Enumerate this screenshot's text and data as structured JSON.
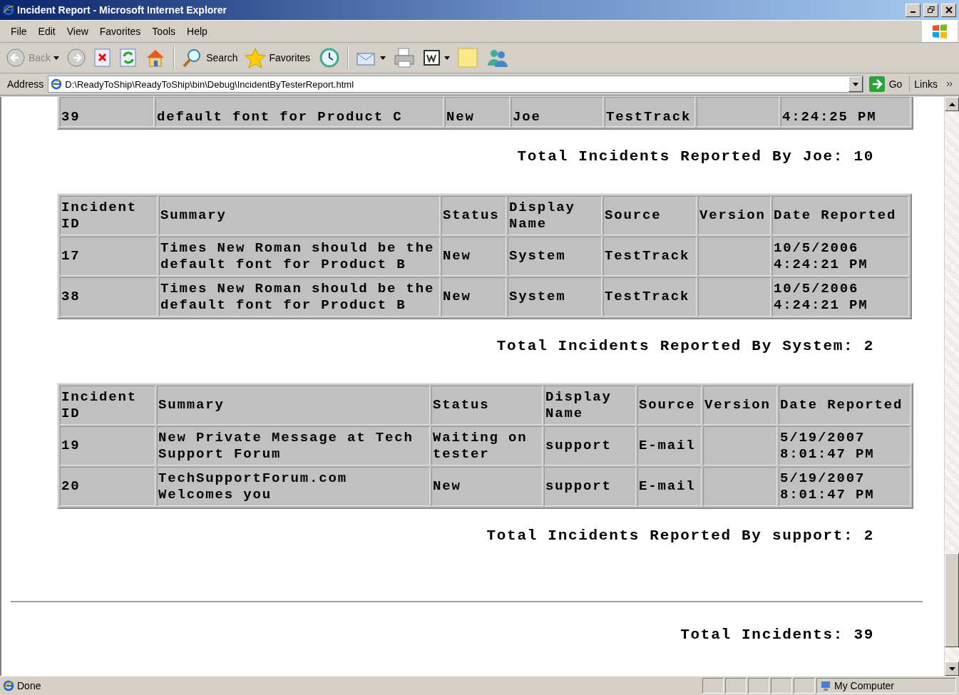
{
  "window": {
    "title": "Incident Report - Microsoft Internet Explorer"
  },
  "menu": [
    "File",
    "Edit",
    "View",
    "Favorites",
    "Tools",
    "Help"
  ],
  "toolbar": {
    "back": "Back",
    "search": "Search",
    "favorites": "Favorites"
  },
  "address": {
    "label": "Address",
    "value": "D:\\ReadyToShip\\ReadyToShip\\bin\\Debug\\IncidentByTesterReport.html",
    "go": "Go",
    "links": "Links"
  },
  "top_row": {
    "id": "39",
    "summary": "default font for Product C",
    "status": "New",
    "display_name": "Joe",
    "source": "TestTrack",
    "date_reported": "4:24:25 PM"
  },
  "top_total": "Total Incidents Reported By Joe: 10",
  "sections": [
    {
      "columns": [
        "Incident ID",
        "Summary",
        "Status",
        "Display Name",
        "Source",
        "Version",
        "Date Reported"
      ],
      "rows": [
        {
          "id": "17",
          "summary": "Times New Roman should be the default font for Product B",
          "status": "New",
          "display_name": "System",
          "source": "TestTrack",
          "date_reported": "10/5/2006 4:24:21 PM"
        },
        {
          "id": "38",
          "summary": "Times New Roman should be the default font for Product B",
          "status": "New",
          "display_name": "System",
          "source": "TestTrack",
          "date_reported": "10/5/2006 4:24:21 PM"
        }
      ],
      "total": "Total Incidents Reported By System: 2"
    },
    {
      "columns": [
        "Incident ID",
        "Summary",
        "Status",
        "Display Name",
        "Source",
        "Version",
        "Date Reported"
      ],
      "rows": [
        {
          "id": "19",
          "summary": "New Private Message at Tech Support Forum",
          "status": "Waiting on tester",
          "display_name": "support",
          "source": "E-mail",
          "date_reported": "5/19/2007 8:01:47 PM"
        },
        {
          "id": "20",
          "summary": "TechSupportForum.com Welcomes you",
          "status": "New",
          "display_name": "support",
          "source": "E-mail",
          "date_reported": "5/19/2007 8:01:47 PM"
        }
      ],
      "total": "Total Incidents Reported By support: 2"
    }
  ],
  "grand_total": "Total Incidents: 39",
  "status_bar": {
    "text": "Done",
    "zone": "My Computer"
  }
}
